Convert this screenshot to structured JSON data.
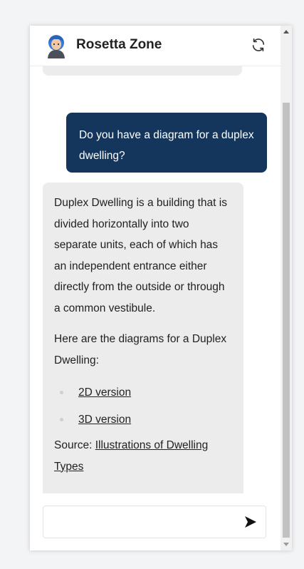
{
  "header": {
    "title": "Rosetta Zone"
  },
  "icons": {
    "avatar": "avatar-icon",
    "refresh": "refresh-icon",
    "send": "send-icon"
  },
  "messages": {
    "user": {
      "text": "Do you have a diagram for a duplex dwelling?"
    },
    "bot": {
      "paragraph1": "Duplex Dwelling is a building that is divided horizontally into two separate units, each of which has an independent entrance either directly from the outside or through a common vestibule.",
      "paragraph2": "Here are the diagrams for a Duplex Dwelling:",
      "links": [
        {
          "label": "2D version"
        },
        {
          "label": "3D version"
        }
      ],
      "source_prefix": "Source: ",
      "source_link": "Illustrations of Dwelling Types"
    }
  },
  "input": {
    "value": "",
    "placeholder": ""
  },
  "colors": {
    "user_bubble": "#14365c",
    "bot_bubble": "#ececec",
    "page_background": "#f3f4f5"
  }
}
